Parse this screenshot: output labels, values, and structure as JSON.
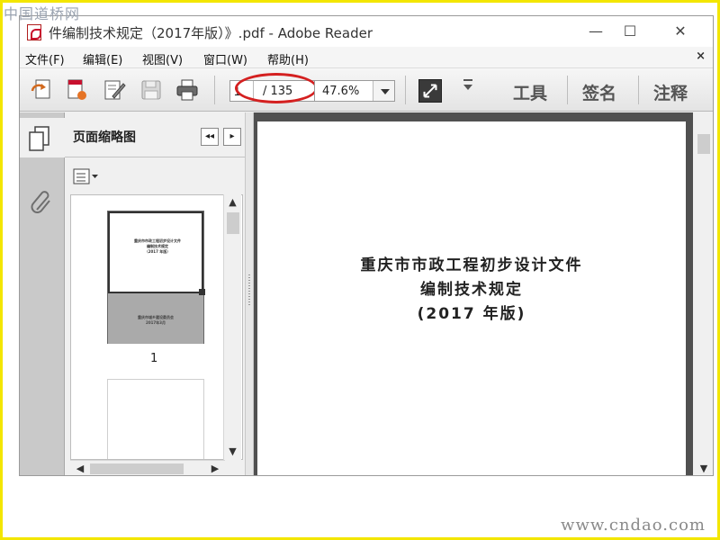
{
  "watermarks": {
    "top": "中国道桥网",
    "bottom": "www.cndao.com"
  },
  "window": {
    "title": "件编制技术规定（2017年版）》.pdf - Adobe Reader",
    "controls": {
      "minimize": "—",
      "maximize": "☐",
      "close": "✕"
    }
  },
  "menu": {
    "items": [
      "文件(F)",
      "编辑(E)",
      "视图(V)",
      "窗口(W)",
      "帮助(H)"
    ],
    "close_doc": "×"
  },
  "toolbar": {
    "page_current": "1",
    "page_total": "/ 135",
    "zoom": "47.6%",
    "tools_label": "工具",
    "sign_label": "签名",
    "comment_label": "注释"
  },
  "sidebar": {
    "panel_title": "页面缩略图",
    "nav_prev": "◂◂",
    "nav_next": "▸",
    "thumbnails": [
      {
        "page_number": "1",
        "cover_lines": [
          "重庆市市政工程初步设计文件",
          "编制技术规定",
          "（2017 年版）"
        ],
        "footer_lines": [
          "重庆市城乡建设委员会",
          "2017年3月"
        ]
      }
    ]
  },
  "document": {
    "title_lines": [
      "重庆市市政工程初步设计文件",
      "编制技术规定",
      "(2017 年版)"
    ]
  },
  "colors": {
    "frame": "#f3e600",
    "annotation_circle": "#d42020",
    "doc_background": "#505050"
  }
}
